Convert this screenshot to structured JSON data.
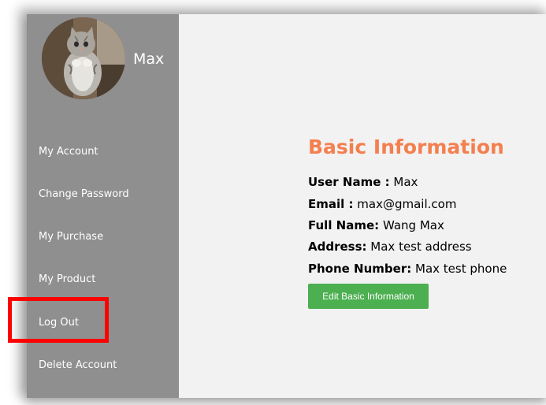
{
  "sidebar": {
    "username": "Max",
    "avatar_icon": "cat-avatar",
    "items": [
      {
        "label": "My Account"
      },
      {
        "label": "Change Password"
      },
      {
        "label": "My Purchase"
      },
      {
        "label": "My Product"
      },
      {
        "label": "Log Out"
      },
      {
        "label": "Delete Account"
      }
    ]
  },
  "main": {
    "title": "Basic Information",
    "fields": [
      {
        "label": "User Name :",
        "value": "Max"
      },
      {
        "label": "Email :",
        "value": "max@gmail.com"
      },
      {
        "label": "Full Name:",
        "value": "Wang Max"
      },
      {
        "label": "Address:",
        "value": "Max test address"
      },
      {
        "label": "Phone Number:",
        "value": "Max test phone"
      }
    ],
    "edit_button_label": "Edit Basic Information"
  },
  "colors": {
    "sidebar_bg": "#8f8f8f",
    "title": "#f47f4f",
    "button": "#4caf50",
    "highlight": "#ff0000"
  }
}
